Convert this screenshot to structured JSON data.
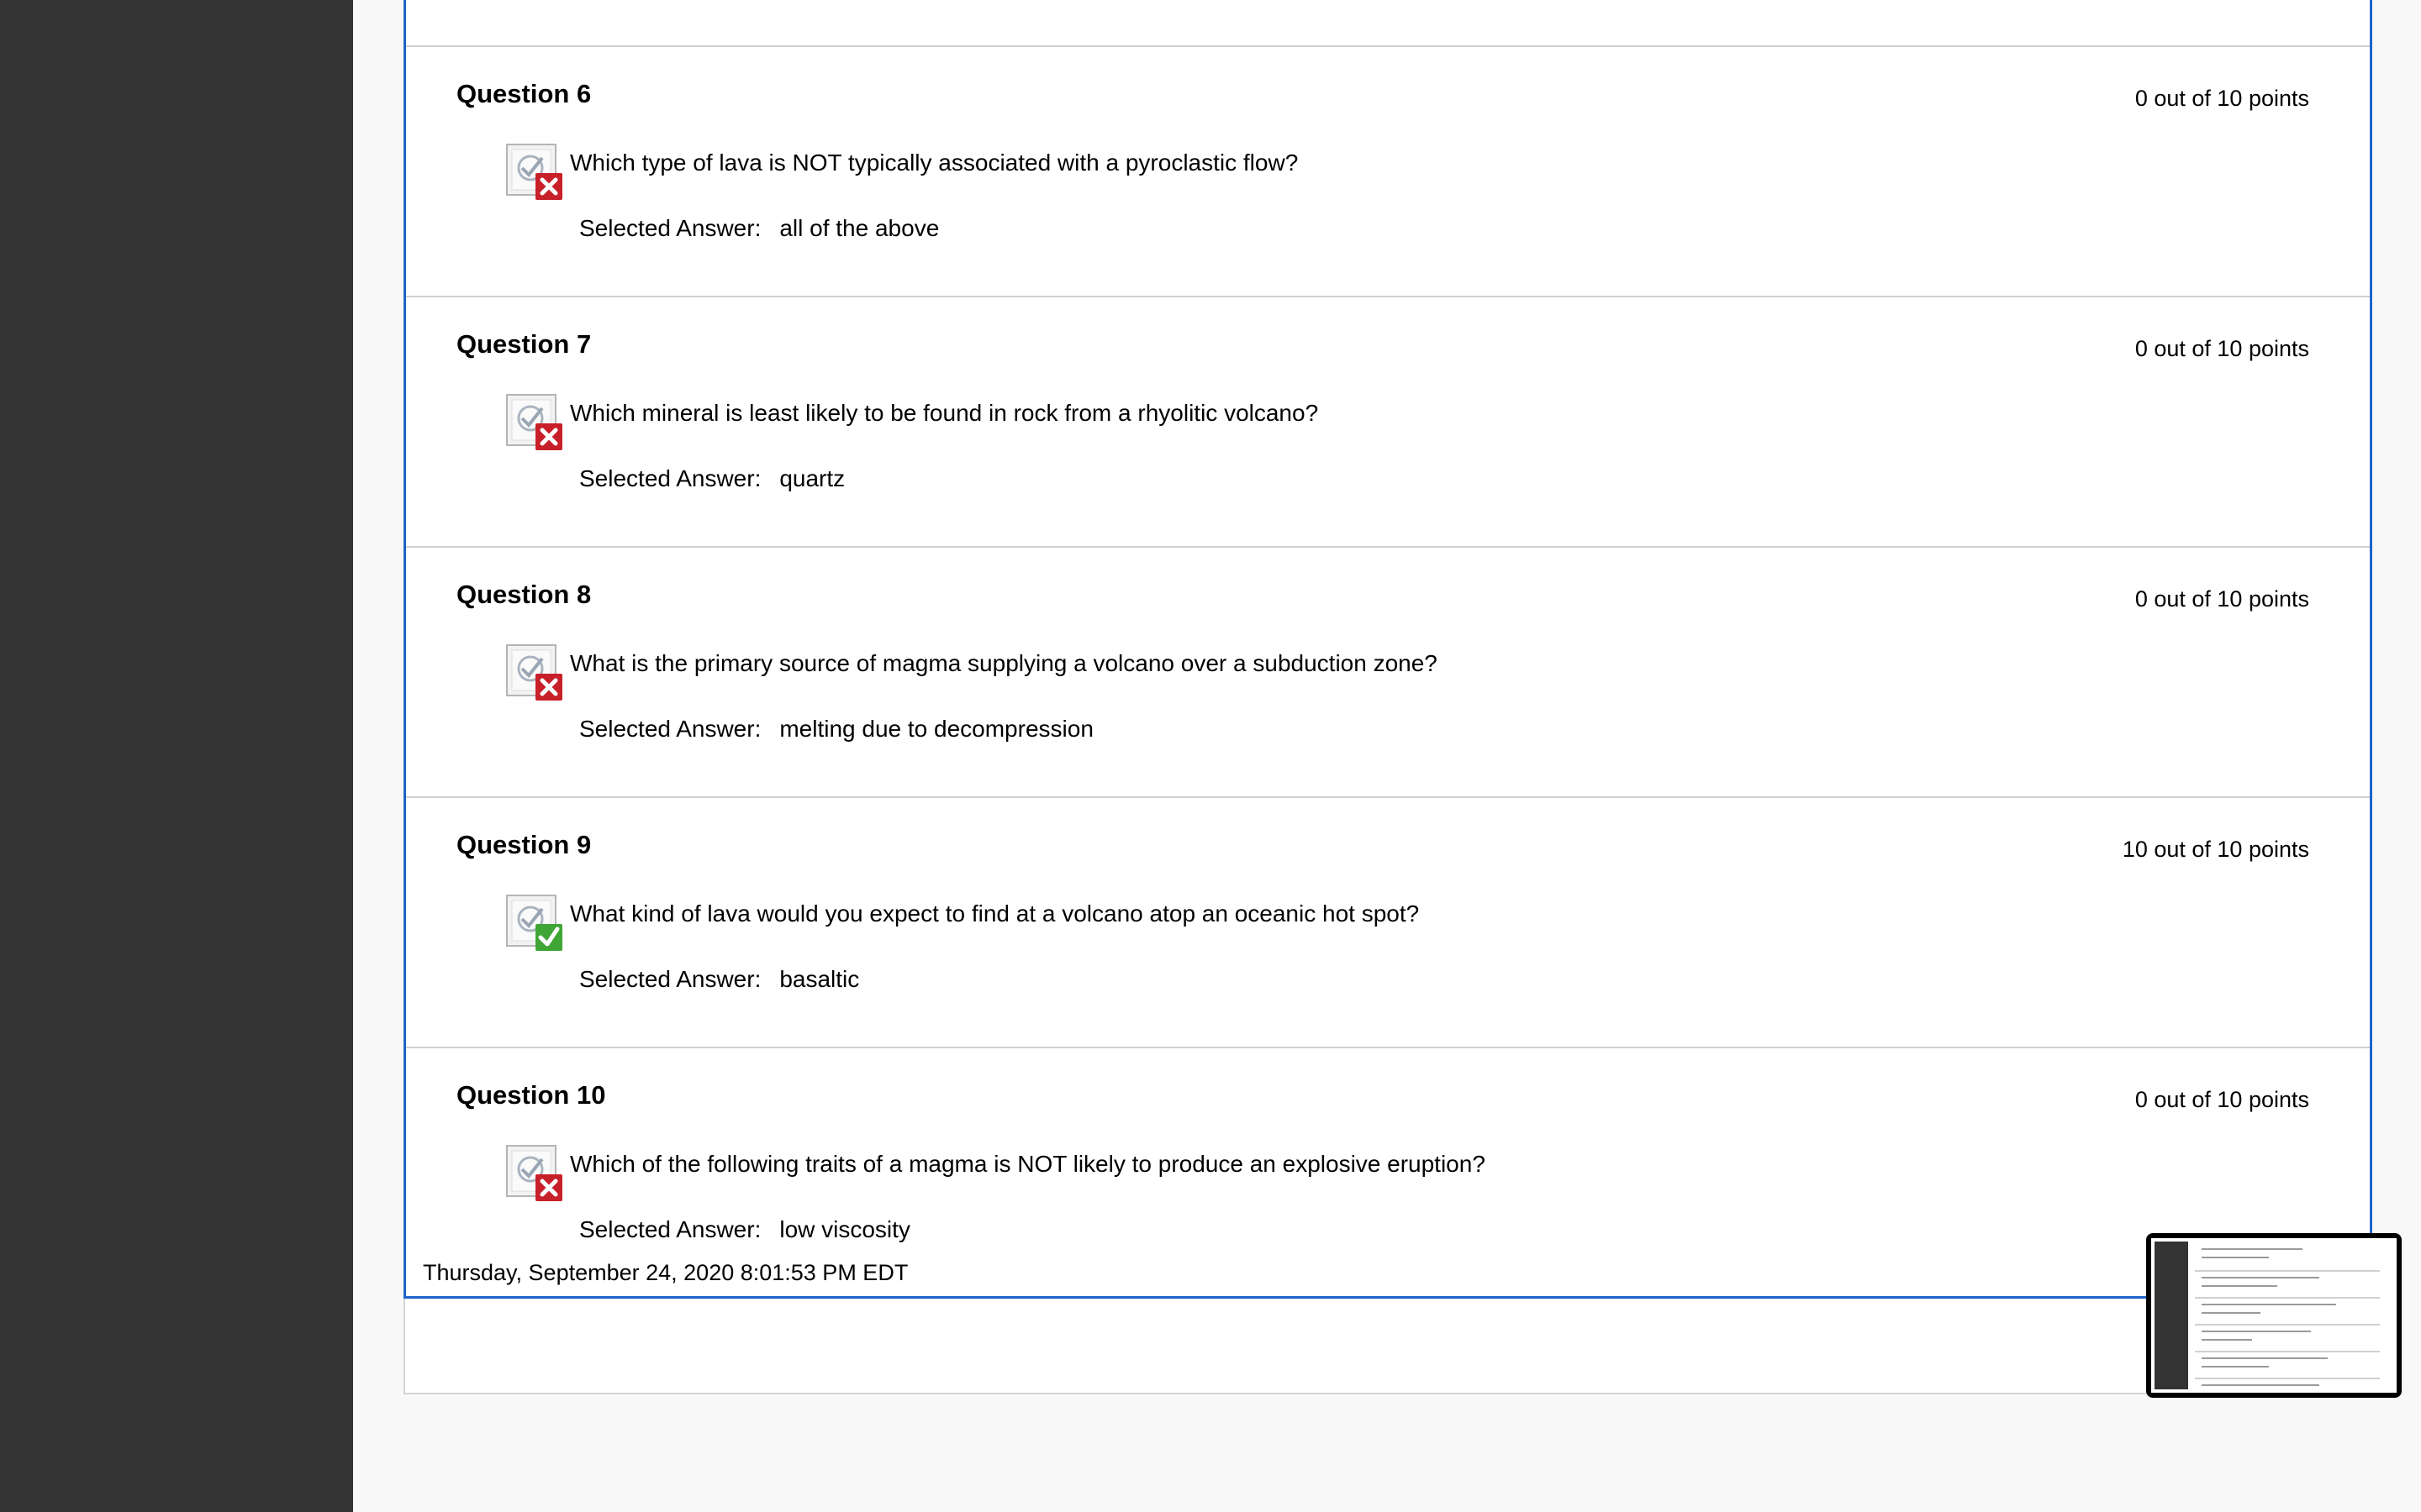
{
  "questions": [
    {
      "title": "Question 6",
      "points": "0 out of 10 points",
      "icon": "incorrect-icon",
      "text": "Which type of lava is NOT typically associated with a pyroclastic flow?",
      "answer_label": "Selected Answer:",
      "answer": "all of the above"
    },
    {
      "title": "Question 7",
      "points": "0 out of 10 points",
      "icon": "incorrect-icon",
      "text": "Which mineral is least likely to be found in rock from a rhyolitic volcano?",
      "answer_label": "Selected Answer:",
      "answer": "quartz"
    },
    {
      "title": "Question 8",
      "points": "0 out of 10 points",
      "icon": "incorrect-icon",
      "text": "What is the primary source of magma supplying a volcano over a subduction zone?",
      "answer_label": "Selected Answer:",
      "answer": "melting due to decompression"
    },
    {
      "title": "Question 9",
      "points": "10 out of 10 points",
      "icon": "correct-icon",
      "text": "What kind of lava would you expect to find at a volcano atop an oceanic hot spot?",
      "answer_label": "Selected Answer:",
      "answer": "basaltic"
    },
    {
      "title": "Question 10",
      "points": "0 out of 10 points",
      "icon": "incorrect-icon",
      "text": "Which of the following traits of a magma is NOT likely to produce an explosive eruption?",
      "answer_label": "Selected Answer:",
      "answer": "low viscosity"
    }
  ],
  "footer": {
    "timestamp": "Thursday, September 24, 2020 8:01:53 PM EDT"
  },
  "colors": {
    "sidebar": "#333333",
    "accent_border": "#1e64c8",
    "incorrect": "#c8202a",
    "correct": "#3fa535"
  }
}
